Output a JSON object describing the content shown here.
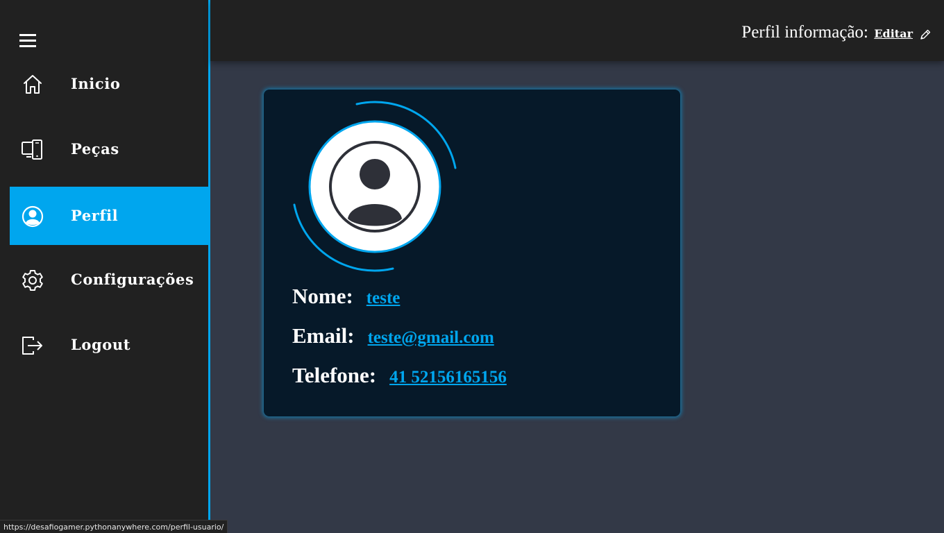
{
  "sidebar": {
    "items": [
      {
        "label": "Inicio",
        "icon": "home-icon"
      },
      {
        "label": "Peças",
        "icon": "devices-icon"
      },
      {
        "label": "Perfil",
        "icon": "user-circle-icon",
        "active": true
      },
      {
        "label": "Configurações",
        "icon": "gear-icon"
      },
      {
        "label": "Logout",
        "icon": "logout-icon"
      }
    ]
  },
  "header": {
    "title": "Perfil informação:",
    "edit_label": "Editar",
    "edit_icon": "pencil-icon"
  },
  "profile": {
    "avatar_icon": "user-avatar-icon",
    "fields": [
      {
        "label": "Nome:",
        "value": "teste"
      },
      {
        "label": "Email:",
        "value": "teste@gmail.com"
      },
      {
        "label": "Telefone:",
        "value": "41 52156165156"
      }
    ]
  },
  "status_bar": {
    "url": "https://desafiogamer.pythonanywhere.com/perfil-usuario/"
  },
  "colors": {
    "accent": "#00a6ee",
    "sidebar_bg": "#212121",
    "page_bg": "#333947",
    "card_bg": "#061929"
  }
}
